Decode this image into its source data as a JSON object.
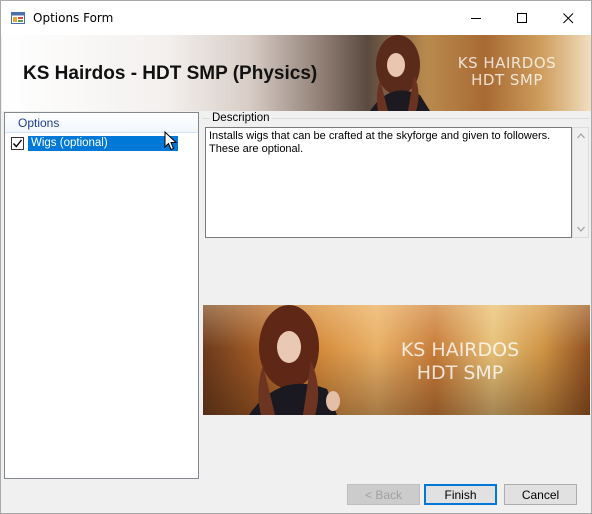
{
  "window": {
    "title": "Options Form",
    "icons": [
      "app-icon",
      "minimize-icon",
      "maximize-icon",
      "close-icon"
    ]
  },
  "banner": {
    "title": "KS Hairdos - HDT SMP (Physics)",
    "logo_line1": "KS HAIRDOS",
    "logo_line2": "HDT SMP"
  },
  "options": {
    "header": "Options",
    "items": [
      {
        "label": "Wigs (optional)",
        "checked": true,
        "selected": true
      }
    ]
  },
  "description": {
    "legend": "Description",
    "text": "Installs wigs that can be crafted at the skyforge and given to followers.\nThese are optional."
  },
  "preview": {
    "logo_line1": "KS HAIRDOS",
    "logo_line2": "HDT SMP"
  },
  "buttons": {
    "back": "< Back",
    "finish": "Finish",
    "cancel": "Cancel"
  },
  "colors": {
    "selection": "#0078d7",
    "options_header_text": "#1e3f8f"
  }
}
